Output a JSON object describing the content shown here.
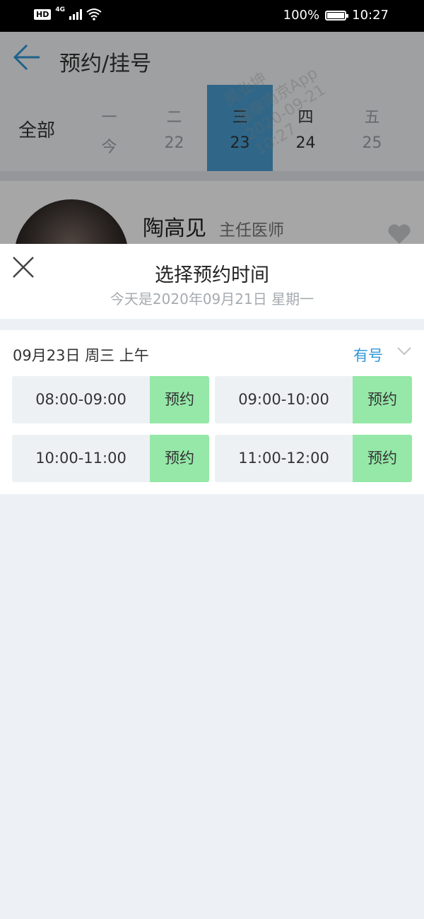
{
  "status_bar": {
    "hd": "HD",
    "network": "4G",
    "battery": "100%",
    "time": "10:27"
  },
  "nav": {
    "title": "预约/挂号"
  },
  "days": {
    "all_label": "全部",
    "items": [
      {
        "weekday": "一",
        "date": "今"
      },
      {
        "weekday": "二",
        "date": "22"
      },
      {
        "weekday": "三",
        "date": "23"
      },
      {
        "weekday": "四",
        "date": "24"
      },
      {
        "weekday": "五",
        "date": "25"
      }
    ]
  },
  "doctor": {
    "name": "陶高见",
    "title": "主任医师"
  },
  "watermark": {
    "line1": "吴业坤",
    "line2": "健康南京App",
    "line3": "2020-09-21",
    "line4": "10:27"
  },
  "sheet": {
    "title": "选择预约时间",
    "subtitle": "今天是2020年09月21日 星期一",
    "slot_header": "09月23日 周三 上午",
    "availability": "有号",
    "slots": [
      {
        "time": "08:00-09:00",
        "action": "预约"
      },
      {
        "time": "09:00-10:00",
        "action": "预约"
      },
      {
        "time": "10:00-11:00",
        "action": "预约"
      },
      {
        "time": "11:00-12:00",
        "action": "预约"
      }
    ]
  },
  "colors": {
    "accent": "#2f98d8",
    "selected_day": "#4a9fd3",
    "book_button": "#95e8a8"
  }
}
